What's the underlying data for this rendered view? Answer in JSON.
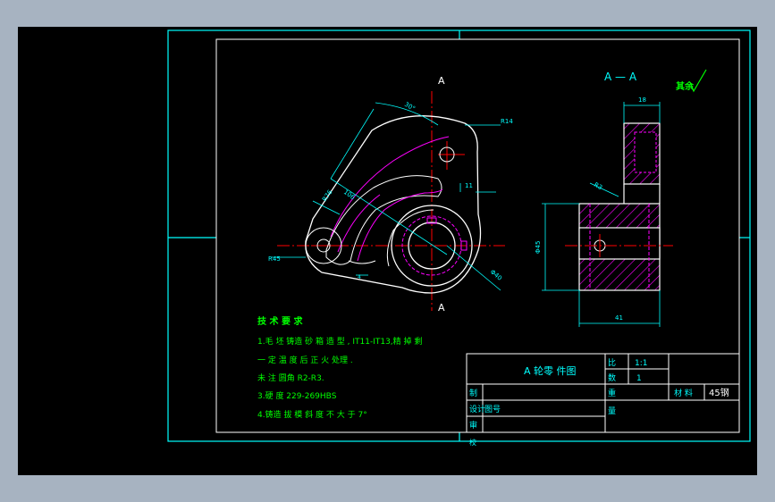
{
  "colors": {
    "page_bg": "#a7b3c1",
    "canvas_bg": "#000000",
    "frame": "#00ffff",
    "outline": "#ffffff",
    "hidden": "#ff00ff",
    "center_line": "#ff0000",
    "dimension": "#00ffff",
    "hatch": "#ff00ff",
    "notes": "#00ff00",
    "title_text": "#ffffff"
  },
  "section": {
    "cut_label_top": "A",
    "cut_label_bottom": "A",
    "view_title": "A — A",
    "roughness_note": "其余"
  },
  "dimensions": {
    "angle": "30°",
    "radius_top": "R14",
    "horizontal_offset": "11",
    "left_radius": "R45",
    "bore": "Φ40",
    "slot": "R76",
    "arc_len": "106",
    "small_gap": "4",
    "section_width": "18",
    "section_thick": "R3",
    "section_height": "Φ45",
    "section_bottom": "41"
  },
  "notes": {
    "title": "技 术 要 求",
    "lines": [
      "1.毛 坯 铸造 砂 箱 造 型 , IT11-IT13,精 掉 剩",
      "一 定 温 度 后 正 火 处理 .",
      "未 注 圆角 R2-R3.",
      "3.硬 度 229-269HBS",
      "4.铸造 拔 模 斜 度 不 大 于 7°"
    ]
  },
  "title_block": {
    "part_name": "A 轮零 件图",
    "scale_label": "比",
    "scale_value": "1:1",
    "quantity_label": "数",
    "quantity_value": "1",
    "material_label": "材 料",
    "material_value": "45钢",
    "weight_label": "重",
    "draw_label": "制",
    "design_label": "设计",
    "review_label": "审",
    "qty_row_label": "量",
    "sheet_label": "图号",
    "check_label": "校"
  }
}
